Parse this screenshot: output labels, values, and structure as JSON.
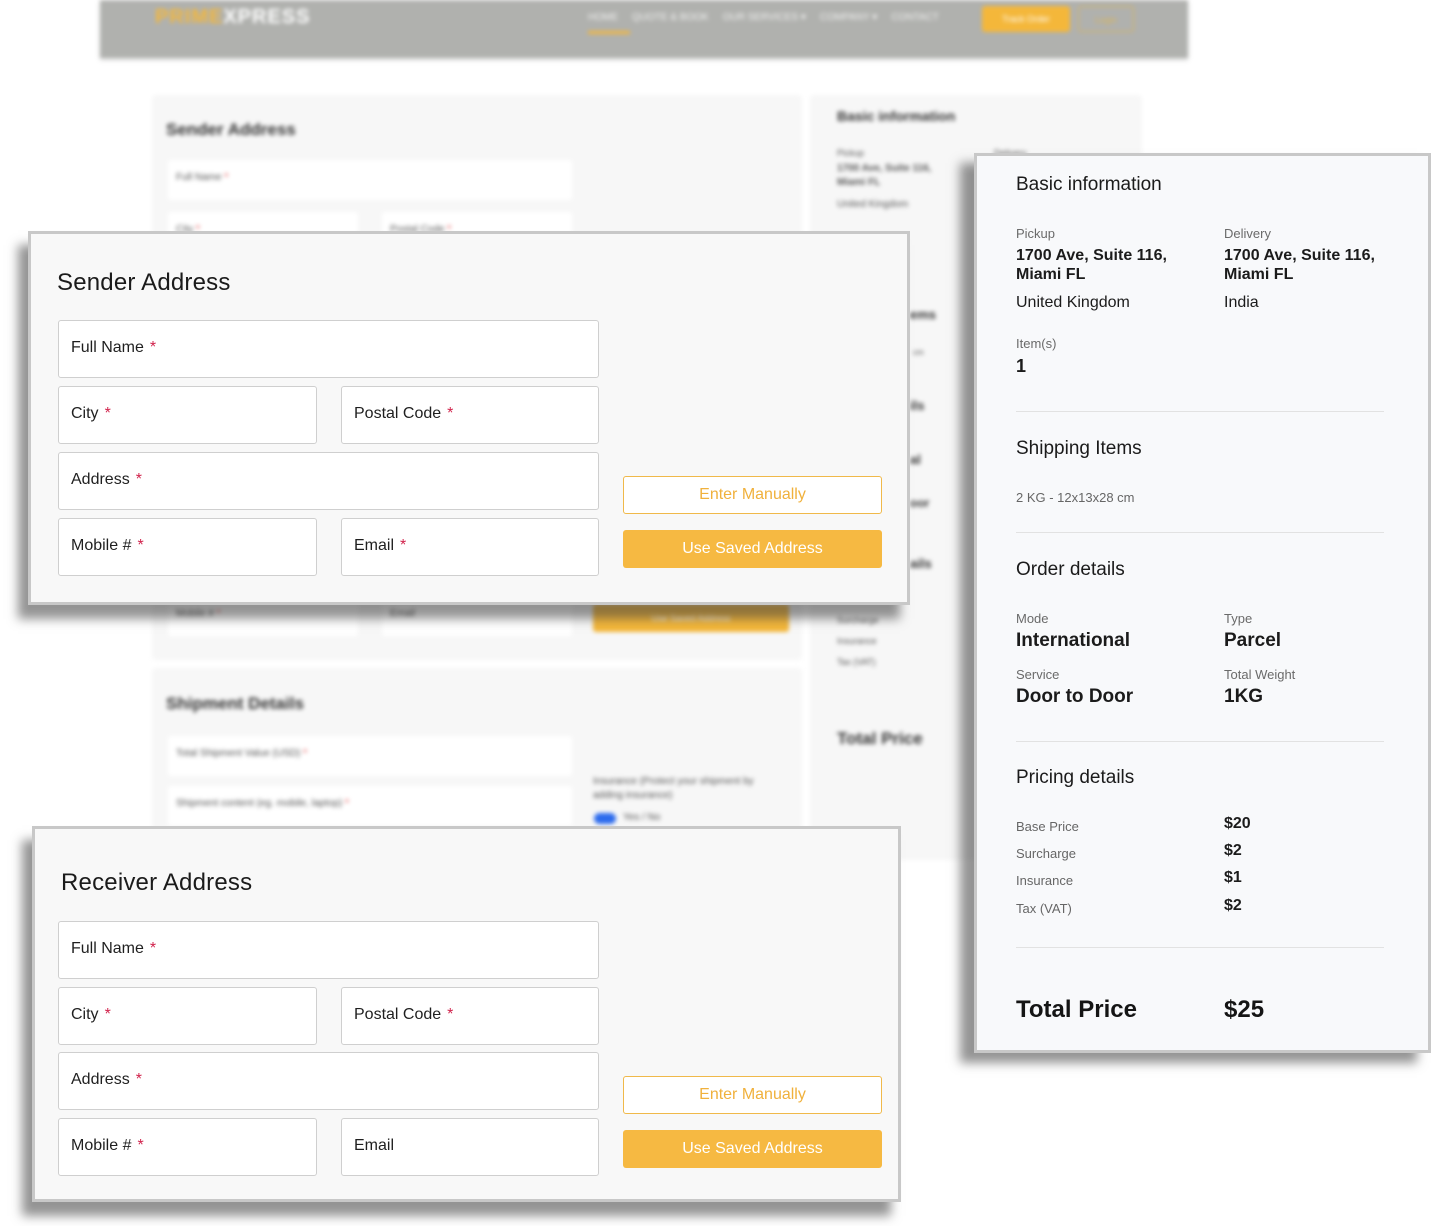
{
  "background": {
    "nav": {
      "logo_part1": "PRIME",
      "logo_part2": "XPRESS",
      "items": [
        "Home",
        "Quote & Book",
        "Our Services ▾",
        "Company ▾",
        "Contact"
      ],
      "track_button": "Track Order",
      "login_button": "Login"
    },
    "sender": {
      "title": "Sender Address",
      "full_name": "Full Name",
      "city": "City",
      "postal_code": "Postal Code",
      "mobile": "Mobile #",
      "email": "Email",
      "use_saved": "Use Saved Address"
    },
    "shipment": {
      "title": "Shipment Details",
      "total_value": "Total Shipment Value (USD)",
      "content": "Shipment content (eg. mobile, laptop)",
      "insurance_line1": "Insurance (Protect your shipment by",
      "insurance_line2": "adding insurance)",
      "toggle_label": "Yes / No"
    },
    "summary": {
      "title": "Basic information",
      "pickup_label": "Pickup",
      "delivery_label": "Delivery",
      "pickup_line1": "1700 Ave, Suite 116,",
      "pickup_line2": "Miami FL",
      "pickup_country": "United Kingdom",
      "frag_items": "ems",
      "frag_dims": "cm",
      "frag_details": "ils",
      "frag_mode": "al",
      "frag_door": "oor",
      "frag_pricing": "ails",
      "surcharge": "Surcharge",
      "insurance": "Insurance",
      "tax": "Tax (VAT)",
      "total": "Total Price"
    }
  },
  "sender_card": {
    "title": "Sender Address",
    "fields": {
      "full_name": {
        "label": "Full Name",
        "required": "*"
      },
      "city": {
        "label": "City",
        "required": "*"
      },
      "postal_code": {
        "label": "Postal Code",
        "required": "*"
      },
      "address": {
        "label": "Address",
        "required": "*"
      },
      "mobile": {
        "label": "Mobile #",
        "required": "*"
      },
      "email": {
        "label": "Email",
        "required": "*"
      }
    },
    "enter_manually": "Enter Manually",
    "use_saved": "Use Saved Address"
  },
  "receiver_card": {
    "title": "Receiver Address",
    "fields": {
      "full_name": {
        "label": "Full Name",
        "required": "*"
      },
      "city": {
        "label": "City",
        "required": "*"
      },
      "postal_code": {
        "label": "Postal Code",
        "required": "*"
      },
      "address": {
        "label": "Address",
        "required": "*"
      },
      "mobile": {
        "label": "Mobile #",
        "required": "*"
      },
      "email": {
        "label": "Email"
      }
    },
    "enter_manually": "Enter Manually",
    "use_saved": "Use Saved Address"
  },
  "summary_card": {
    "basic": {
      "title": "Basic information",
      "pickup_label": "Pickup",
      "pickup_line1": "1700 Ave, Suite 116,",
      "pickup_line2": "Miami FL",
      "pickup_country": "United Kingdom",
      "delivery_label": "Delivery",
      "delivery_line1": "1700 Ave, Suite 116,",
      "delivery_line2": "Miami FL",
      "delivery_country": "India",
      "items_label": "Item(s)",
      "items_value": "1"
    },
    "shipping": {
      "title": "Shipping Items",
      "item": "2 KG - 12x13x28 cm"
    },
    "order": {
      "title": "Order details",
      "mode_label": "Mode",
      "mode_value": "International",
      "type_label": "Type",
      "type_value": "Parcel",
      "service_label": "Service",
      "service_value": "Door to Door",
      "weight_label": "Total Weight",
      "weight_value": "1KG"
    },
    "pricing": {
      "title": "Pricing details",
      "rows": [
        {
          "label": "Base Price",
          "value": "$20"
        },
        {
          "label": "Surcharge",
          "value": "$2"
        },
        {
          "label": "Insurance",
          "value": "$1"
        },
        {
          "label": "Tax (VAT)",
          "value": "$2"
        }
      ]
    },
    "total": {
      "label": "Total Price",
      "value": "$25"
    }
  },
  "colors": {
    "accent": "#f6b942",
    "required": "#d1224b",
    "toggle": "#2c6bed"
  }
}
